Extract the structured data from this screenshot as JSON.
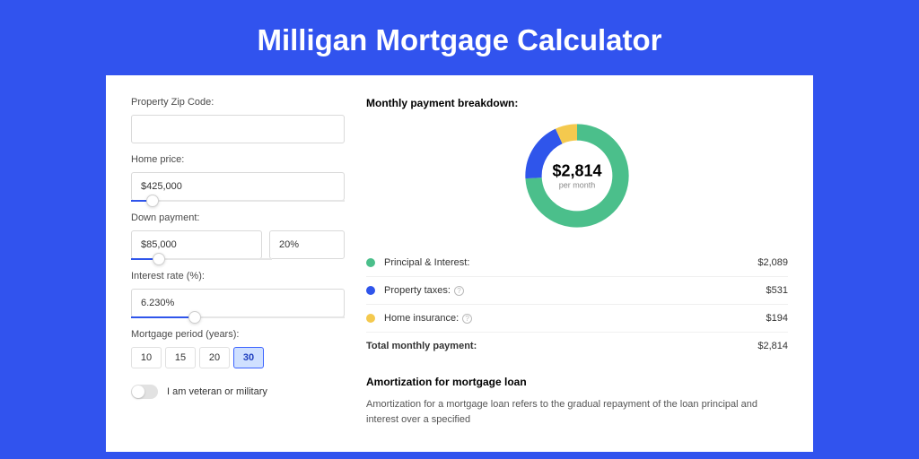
{
  "page": {
    "title": "Milligan Mortgage Calculator"
  },
  "form": {
    "zip": {
      "label": "Property Zip Code:",
      "value": ""
    },
    "price": {
      "label": "Home price:",
      "value": "$425,000",
      "slider_pct": 10
    },
    "down": {
      "label": "Down payment:",
      "amount": "$85,000",
      "pct": "20%",
      "slider_pct": 20
    },
    "rate": {
      "label": "Interest rate (%):",
      "value": "6.230%",
      "slider_pct": 30
    },
    "period": {
      "label": "Mortgage period (years):",
      "options": [
        "10",
        "15",
        "20",
        "30"
      ],
      "active": "30"
    },
    "veteran": {
      "label": "I am veteran or military",
      "on": false
    }
  },
  "breakdown": {
    "title": "Monthly payment breakdown:",
    "center_amount": "$2,814",
    "center_per": "per month",
    "items": [
      {
        "key": "pi",
        "label": "Principal & Interest:",
        "value": "$2,089",
        "color": "#4bbf8b",
        "pct": 74,
        "info": false
      },
      {
        "key": "tax",
        "label": "Property taxes:",
        "value": "$531",
        "color": "#2f55eb",
        "pct": 19,
        "info": true
      },
      {
        "key": "ins",
        "label": "Home insurance:",
        "value": "$194",
        "color": "#f4c94e",
        "pct": 7,
        "info": true
      }
    ],
    "total": {
      "label": "Total monthly payment:",
      "value": "$2,814"
    }
  },
  "amort": {
    "title": "Amortization for mortgage loan",
    "text": "Amortization for a mortgage loan refers to the gradual repayment of the loan principal and interest over a specified"
  },
  "chart_data": {
    "type": "pie",
    "title": "Monthly payment breakdown",
    "categories": [
      "Principal & Interest",
      "Property taxes",
      "Home insurance"
    ],
    "values": [
      2089,
      531,
      194
    ],
    "total": 2814,
    "colors": [
      "#4bbf8b",
      "#2f55eb",
      "#f4c94e"
    ]
  }
}
